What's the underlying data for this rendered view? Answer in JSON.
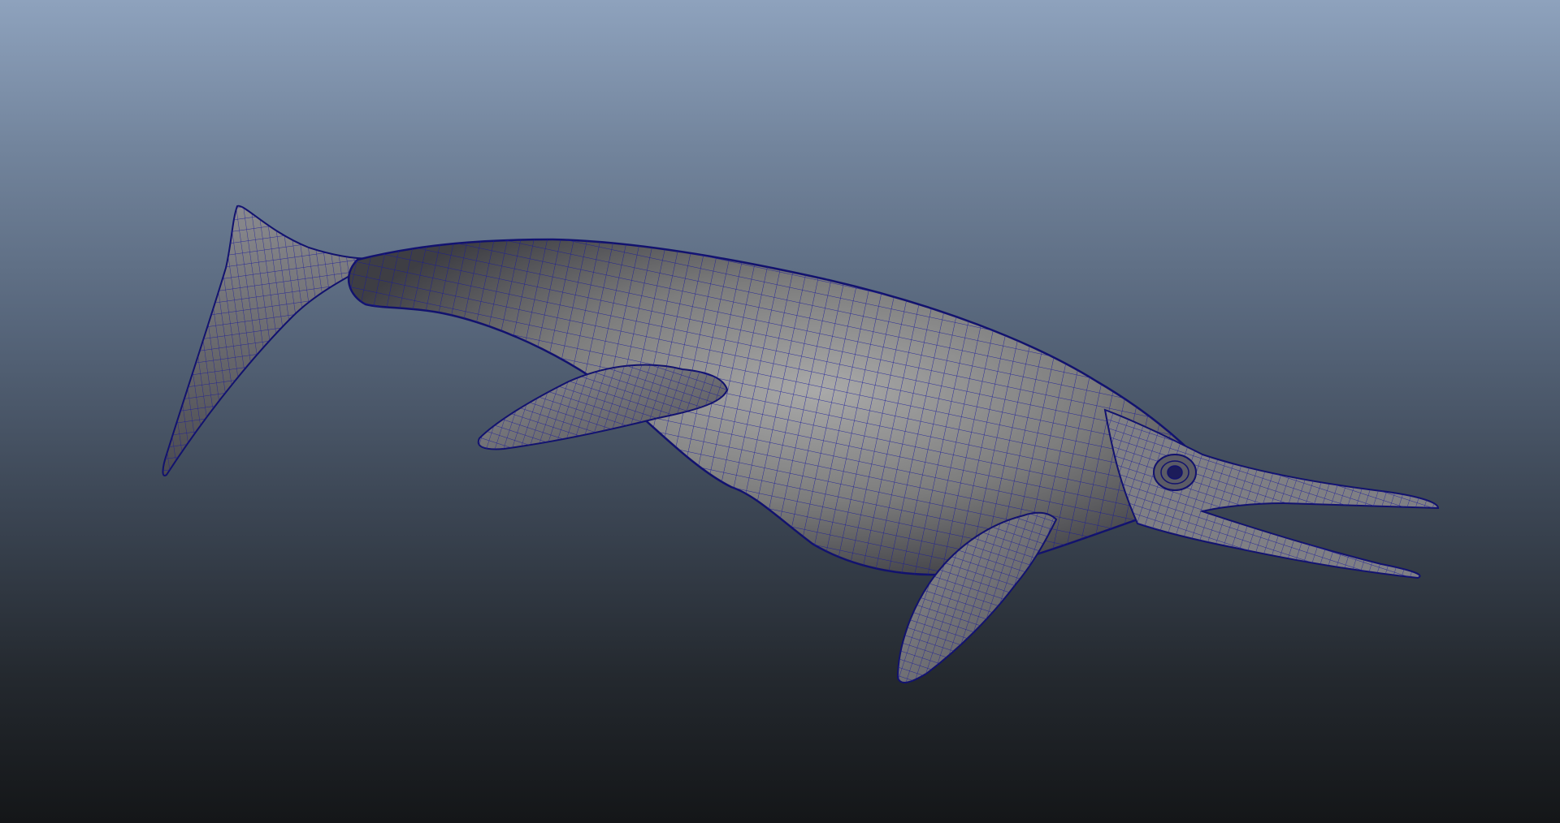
{
  "viewport": {
    "label": "",
    "background_top": "#8ea2bd",
    "background_bottom": "#141618",
    "wireframe_color": "#1a1a9a",
    "shaded_color": "#8a8a8a"
  },
  "model": {
    "name": "",
    "display_mode": "wireframe-on-shaded"
  }
}
